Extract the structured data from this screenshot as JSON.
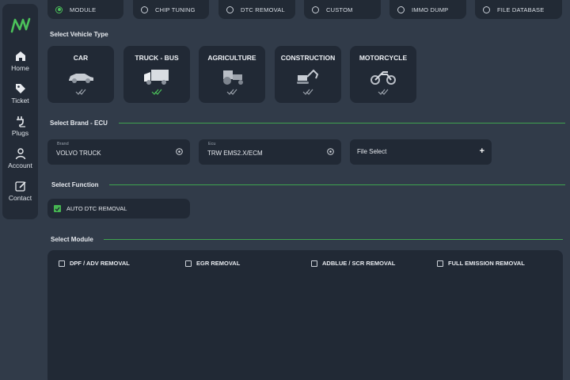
{
  "sidebar": {
    "items": [
      {
        "label": "Home",
        "icon": "home-icon"
      },
      {
        "label": "Ticket",
        "icon": "tag-icon"
      },
      {
        "label": "Plugs",
        "icon": "plug-icon"
      },
      {
        "label": "Account",
        "icon": "user-icon"
      },
      {
        "label": "Contact",
        "icon": "edit-icon"
      }
    ]
  },
  "modes": [
    "MODULE",
    "CHIP TUNING",
    "DTC REMOVAL",
    "CUSTOM",
    "IMMO DUMP",
    "FILE DATABASE"
  ],
  "vehicle": {
    "title": "Select Vehicle Type",
    "types": [
      "CAR",
      "TRUCK - BUS",
      "AGRICULTURE",
      "CONSTRUCTION",
      "MOTORCYCLE"
    ]
  },
  "brand_ecu": {
    "title": "Select Brand - ECU",
    "brand_label": "Brand",
    "brand_value": "VOLVO TRUCK",
    "ecu_label": "Ecu",
    "ecu_value": "TRW EMS2.X/ECM",
    "file_label": "File Select",
    "file_icon": "+"
  },
  "function": {
    "title": "Select Function",
    "option": "AUTO DTC REMOVAL"
  },
  "module": {
    "title": "Select Module",
    "options": [
      "DPF / ADV REMOVAL",
      "EGR REMOVAL",
      "ADBLUE / SCR REMOVAL",
      "FULL EMISSION REMOVAL"
    ]
  },
  "colors": {
    "accent": "#4bbf5a",
    "panel": "#212935",
    "background": "#313b49"
  }
}
